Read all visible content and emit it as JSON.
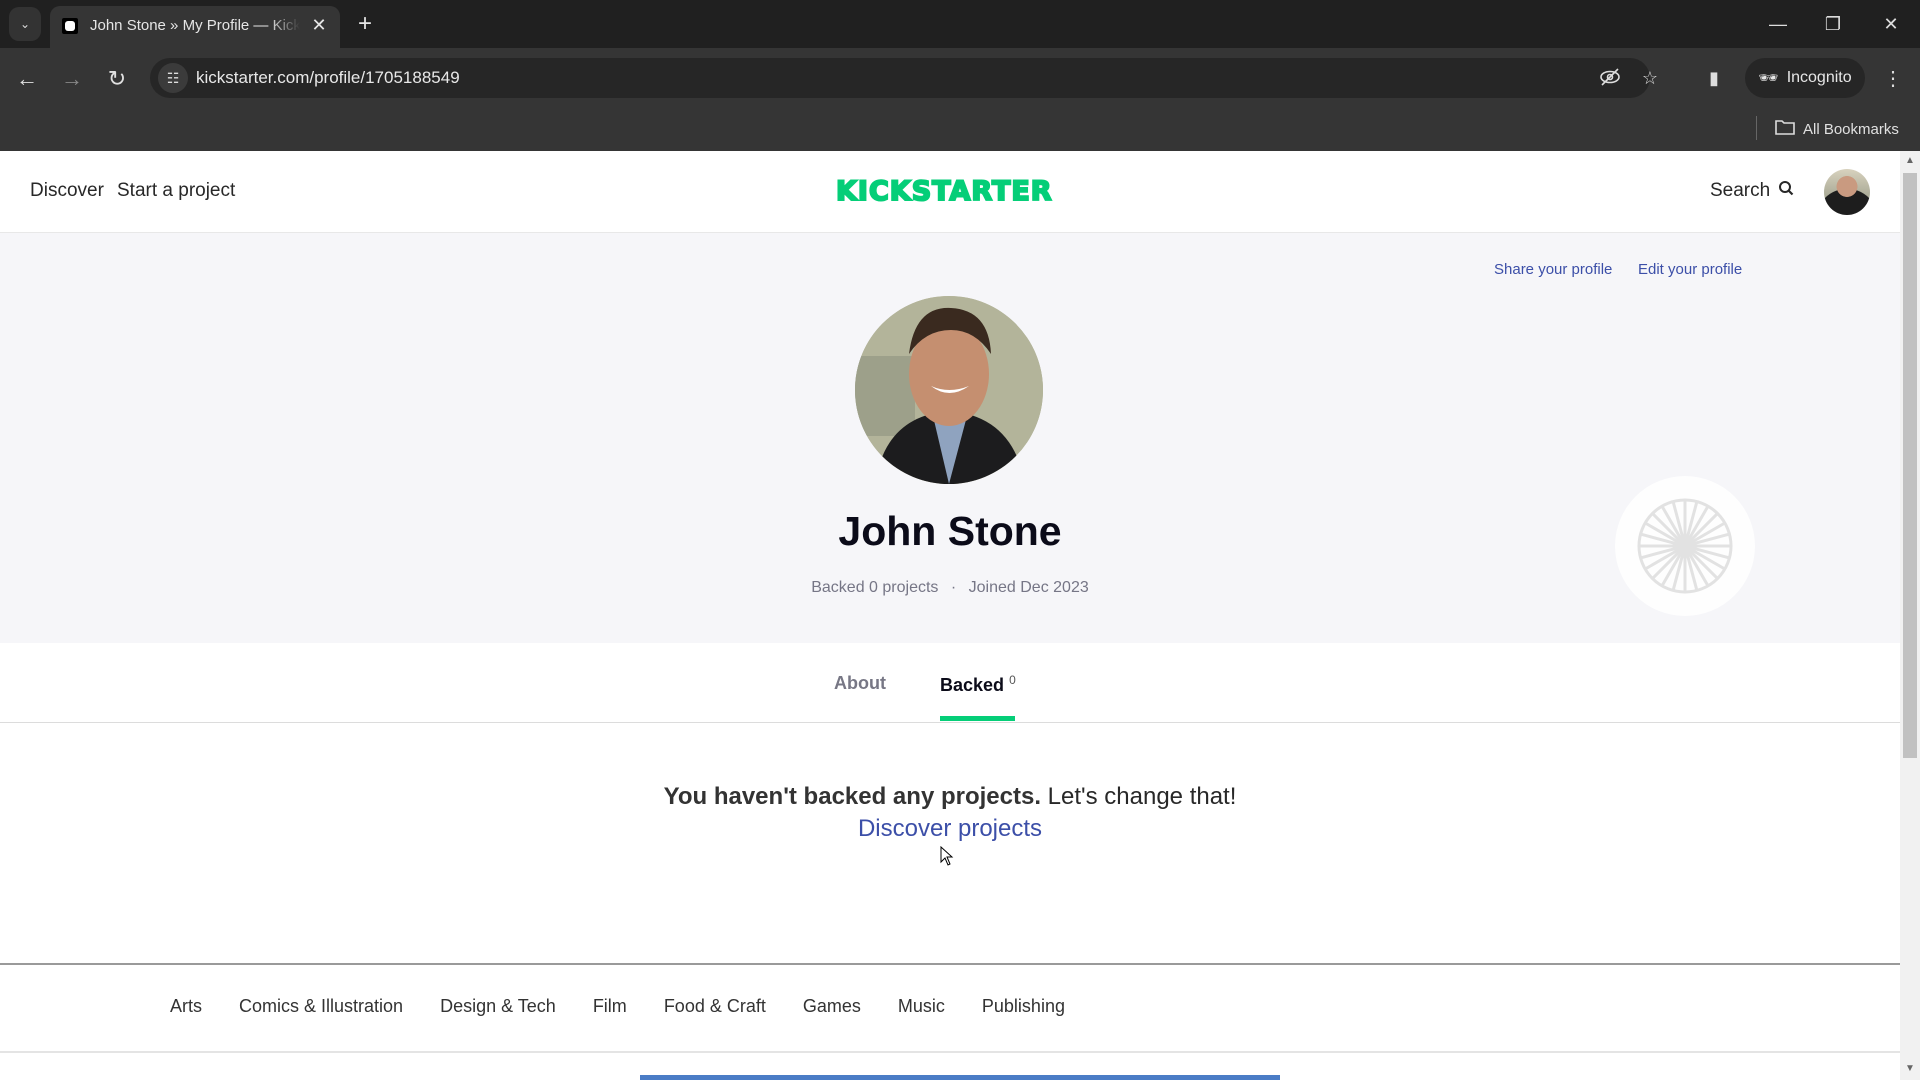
{
  "browser": {
    "tab_title": "John Stone » My Profile — Kickstarter",
    "url": "kickstarter.com/profile/1705188549",
    "incognito_label": "Incognito",
    "bookmarks_label": "All Bookmarks"
  },
  "site_header": {
    "nav": [
      "Discover",
      "Start a project"
    ],
    "logo": "KICKSTARTER",
    "search_label": "Search",
    "brand_color": "#05ce78"
  },
  "profile": {
    "share_label": "Share your profile",
    "edit_label": "Edit your profile",
    "name": "John Stone",
    "backed_text": "Backed 0 projects",
    "separator": "·",
    "joined_text": "Joined Dec 2023",
    "link_color": "#3c4fa8"
  },
  "tabs": [
    {
      "label": "About",
      "active": false
    },
    {
      "label": "Backed",
      "count": "0",
      "active": true
    }
  ],
  "empty_state": {
    "bold": "You haven't backed any projects.",
    "rest": " Let's change that!",
    "link": "Discover projects"
  },
  "categories": [
    "Arts",
    "Comics & Illustration",
    "Design & Tech",
    "Film",
    "Food & Craft",
    "Games",
    "Music",
    "Publishing"
  ]
}
